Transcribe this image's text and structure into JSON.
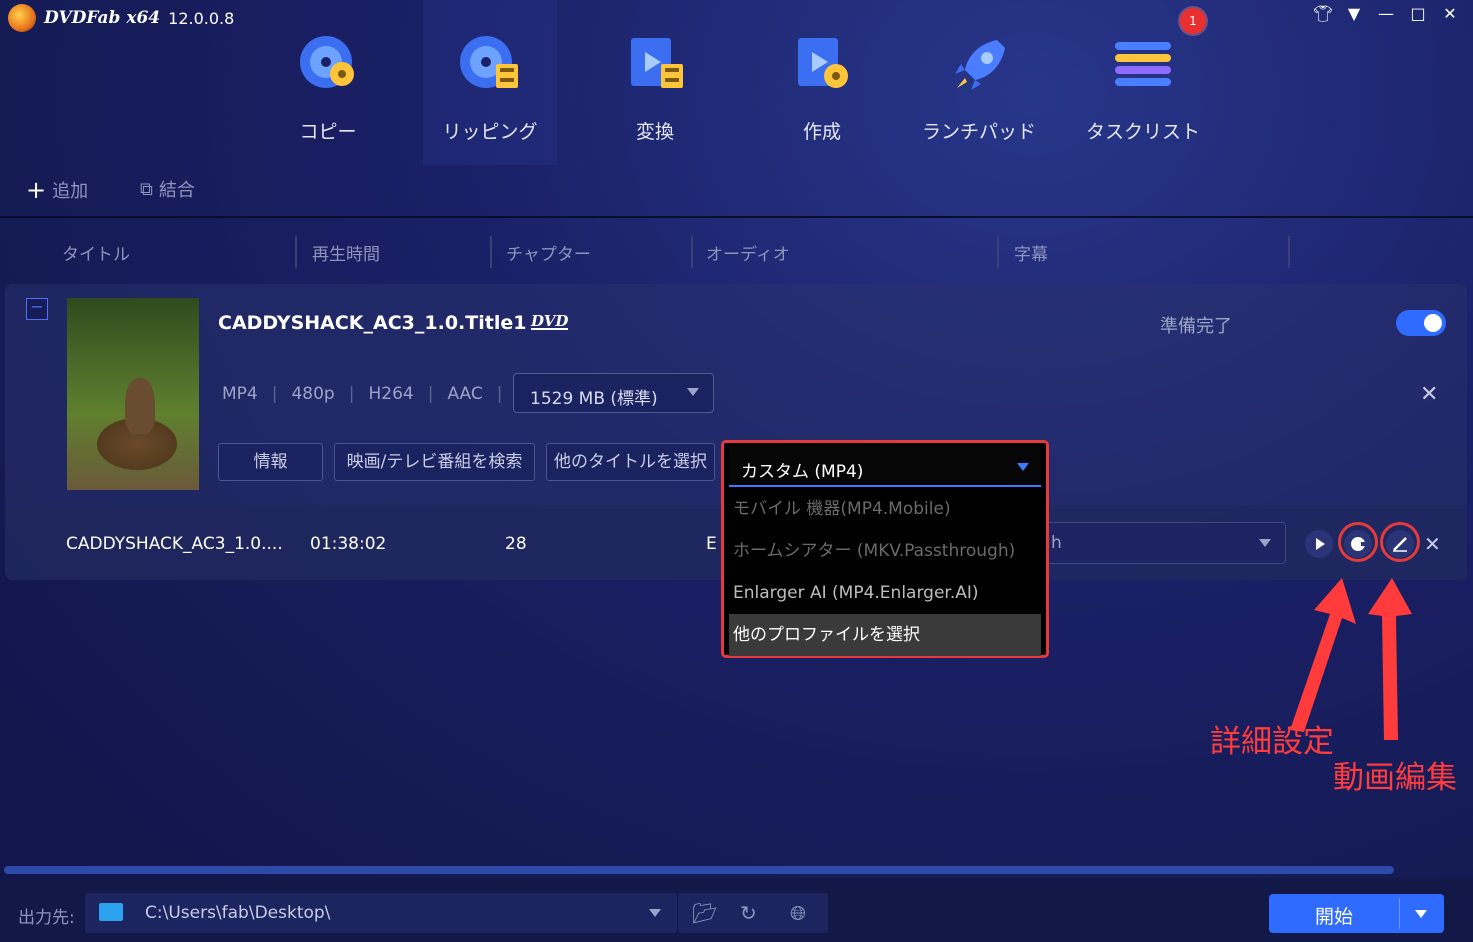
{
  "app": {
    "name": "DVDFab x64",
    "version": "12.0.0.8"
  },
  "nav": {
    "items": [
      {
        "label": "コピー",
        "icon": "copy-disc-icon"
      },
      {
        "label": "リッピング",
        "icon": "ripping-icon"
      },
      {
        "label": "変換",
        "icon": "convert-icon"
      },
      {
        "label": "作成",
        "icon": "create-icon"
      },
      {
        "label": "ランチパッド",
        "icon": "launchpad-rocket-icon"
      },
      {
        "label": "タスクリスト",
        "icon": "tasklist-icon"
      }
    ],
    "active": "リッピング",
    "task_badge": "1"
  },
  "toolbar": {
    "add_label": "追加",
    "merge_label": "結合"
  },
  "columns": [
    "タイトル",
    "再生時間",
    "チャプター",
    "オーディオ",
    "字幕"
  ],
  "title_card": {
    "title": "CADDYSHACK_AC3_1.0.Title1",
    "disc_logo": "DVD",
    "status": "準備完了",
    "toggle_on": true,
    "specs": [
      "MP4",
      "480p",
      "H264",
      "AAC"
    ],
    "size_option": "1529 MB (標準)",
    "buttons": {
      "info": "情報",
      "search": "映画/テレビ番組を検索",
      "other_title": "他のタイトルを選択"
    }
  },
  "title_row": {
    "name": "CADDYSHACK_AC3_1.0....",
    "duration": "01:38:02",
    "chapters": "28",
    "audio_prefix": "E",
    "subtitle_value_fragment": "h"
  },
  "profile_dropdown": {
    "selected": "カスタム (MP4)",
    "options": [
      {
        "label": "モバイル 機器(MP4.Mobile)",
        "state": "disabled"
      },
      {
        "label": "ホームシアター (MKV.Passthrough)",
        "state": "disabled"
      },
      {
        "label": "Enlarger AI (MP4.Enlarger.AI)",
        "state": "normal"
      },
      {
        "label": "他のプロファイルを選択",
        "state": "highlighted"
      }
    ]
  },
  "annotations": {
    "advanced": "詳細設定",
    "video_edit": "動画編集"
  },
  "output": {
    "label": "出力先:",
    "path": "C:\\Users\\fab\\Desktop\\",
    "start_label": "開始"
  },
  "colors": {
    "accent": "#2f6bff",
    "annotation": "#e53a3a",
    "background": "#1a2066"
  }
}
